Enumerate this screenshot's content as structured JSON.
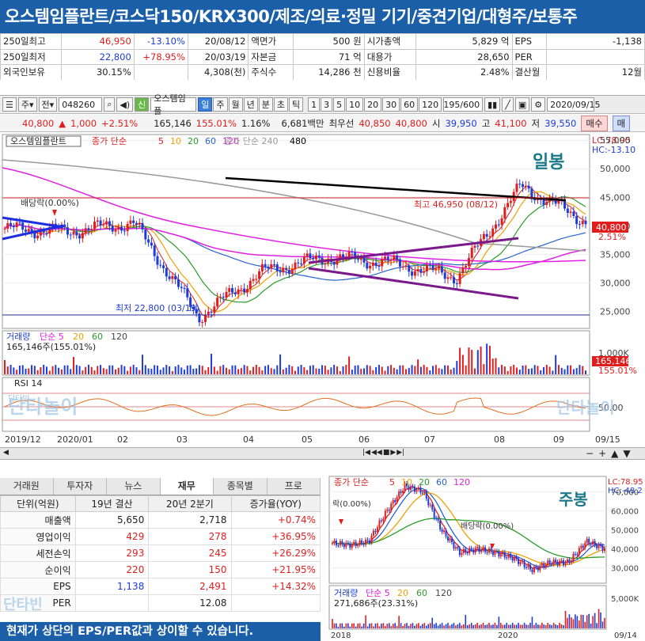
{
  "title": "오스템임플란트/코스닥150/KRX300/제조/의료·정밀 기기/중견기업/대형주/보통주",
  "info": {
    "rows": [
      [
        "250일최고",
        "46,950",
        "-13.10%",
        "20/08/12",
        "액면가",
        "500 원",
        "시가총액",
        "5,829 억",
        "EPS",
        "-1,138"
      ],
      [
        "250일최저",
        "22,800",
        "+78.95%",
        "20/03/19",
        "자본금",
        "71 억",
        "대용가",
        "28,650",
        "PER",
        ""
      ],
      [
        "외국인보유",
        "30.15%",
        "",
        "4,308(천)",
        "주식수",
        "14,286 천",
        "신용비율",
        "2.48%",
        "결산월",
        "12월"
      ]
    ]
  },
  "toolbar": {
    "market": "주",
    "type": "전",
    "code": "048260",
    "name_badge": "신",
    "stock_name": "오스템임플",
    "periods": [
      "일",
      "주",
      "월",
      "년",
      "분",
      "초",
      "틱"
    ],
    "active_period": "일",
    "intervals": [
      "1",
      "3",
      "5",
      "10",
      "20",
      "30",
      "60",
      "120"
    ],
    "count": "195",
    "count_max": "/600",
    "date": "2020/09/15"
  },
  "quote": {
    "price": "40,800",
    "arrow": "▲",
    "change": "1,000",
    "pct": "+2.51%",
    "volume": "165,146",
    "vol_ratio": "155.01%",
    "turnover": "1.16%",
    "amount": "6,681백만",
    "best_label": "최우선",
    "best_ask": "40,850",
    "best_bid": "40,800",
    "open_label": "시",
    "open": "39,950",
    "high_label": "고",
    "high": "41,100",
    "low_label": "저",
    "low": "39,550",
    "buy": "매수",
    "sell": "매"
  },
  "main_chart": {
    "legend_name": "오스템임플란트",
    "legend_ma": "종가 단순",
    "ma_periods": [
      "5",
      "10",
      "20",
      "60",
      "120"
    ],
    "legend_ma2": "종가 단순 240",
    "legend_480": "480",
    "watermark": "일봉",
    "lc": "LC:78.95",
    "hc": "HC:-13.10",
    "dividend_label": "배당락(0.00%)",
    "high_label": "최고 46,950 (08/12)",
    "low_label": "최저 22,800 (03/19)",
    "price_box": "40,800",
    "price_pct": "2.51%",
    "y_ticks": [
      "55,000",
      "50,000",
      "45,000",
      "40,000",
      "35,000",
      "30,000",
      "25,000"
    ],
    "volume_legend": "거래량",
    "volume_ma": "단순 5",
    "volume_ma_periods": [
      "20",
      "60",
      "120"
    ],
    "volume_info": "165,146주(155.01%)",
    "volume_tick": "1,000K",
    "volume_box": "165,146",
    "volume_pct": "155.01%",
    "rsi_legend": "RSI 14",
    "rsi_tick": "50.00",
    "x_labels": [
      "2019/12",
      "2020/01",
      "02",
      "03",
      "04",
      "05",
      "06",
      "07",
      "08",
      "09",
      "09/15"
    ],
    "brand": "단타놀이",
    "brand_small": "단타빈"
  },
  "chart_data": {
    "type": "line",
    "title": "오스템임플란트",
    "ylim": [
      22000,
      56000
    ],
    "x": [
      "2019/12",
      "2020/01",
      "02",
      "03",
      "04",
      "05",
      "06",
      "07",
      "08",
      "09"
    ],
    "series": [
      {
        "name": "종가",
        "values": [
          39500,
          39000,
          40500,
          24000,
          32000,
          34500,
          33500,
          31000,
          46950,
          40800
        ]
      }
    ],
    "high": 46950,
    "low": 22800
  },
  "fin": {
    "tabs": [
      "거래원",
      "투자자",
      "뉴스",
      "재무",
      "종목별",
      "프로"
    ],
    "active_tab": "재무",
    "headers": [
      "단위(억원)",
      "19년 결산",
      "20년 2분기",
      "증가율(YOY)"
    ],
    "rows": [
      [
        "매출액",
        "5,650",
        "2,718",
        "+0.74%"
      ],
      [
        "영업이익",
        "429",
        "278",
        "+36.95%"
      ],
      [
        "세전손익",
        "293",
        "245",
        "+26.29%"
      ],
      [
        "순이익",
        "220",
        "150",
        "+21.95%"
      ],
      [
        "EPS",
        "1,138",
        "2,491",
        "+14.32%"
      ],
      [
        "PER",
        "",
        "12.08",
        ""
      ]
    ],
    "footer": "현재가 상단의 EPS/PER값과 상이할 수 있습니다."
  },
  "weekly_chart": {
    "legend": "종가 단순",
    "ma_periods": [
      "5",
      "10",
      "20",
      "60",
      "120"
    ],
    "watermark": "주봉",
    "lc": "LC:78.95",
    "hc": "HC:-48.2",
    "dividend1": "락(0.00%)",
    "dividend2": "배당락(0.00%)",
    "y_ticks": [
      "70,000",
      "60,000",
      "50,000",
      "40,000",
      "30,000"
    ],
    "volume_legend": "거래량",
    "volume_ma": "단순 5",
    "volume_ma_periods": [
      "20",
      "60",
      "120"
    ],
    "volume_info": "271,686주(23.31%)",
    "volume_tick": "5,000K",
    "x_labels": [
      "2018",
      "2020",
      "09/14"
    ]
  },
  "colors": {
    "brand_blue": "#1a5fa8",
    "up": "#e01e1e",
    "down": "#1e3cd8",
    "ma5": "#e01e1e",
    "ma10": "#f0a000",
    "ma20": "#2a9c2a",
    "ma60": "#2a62d0",
    "ma120": "#e020e0",
    "ma240": "#999999"
  }
}
